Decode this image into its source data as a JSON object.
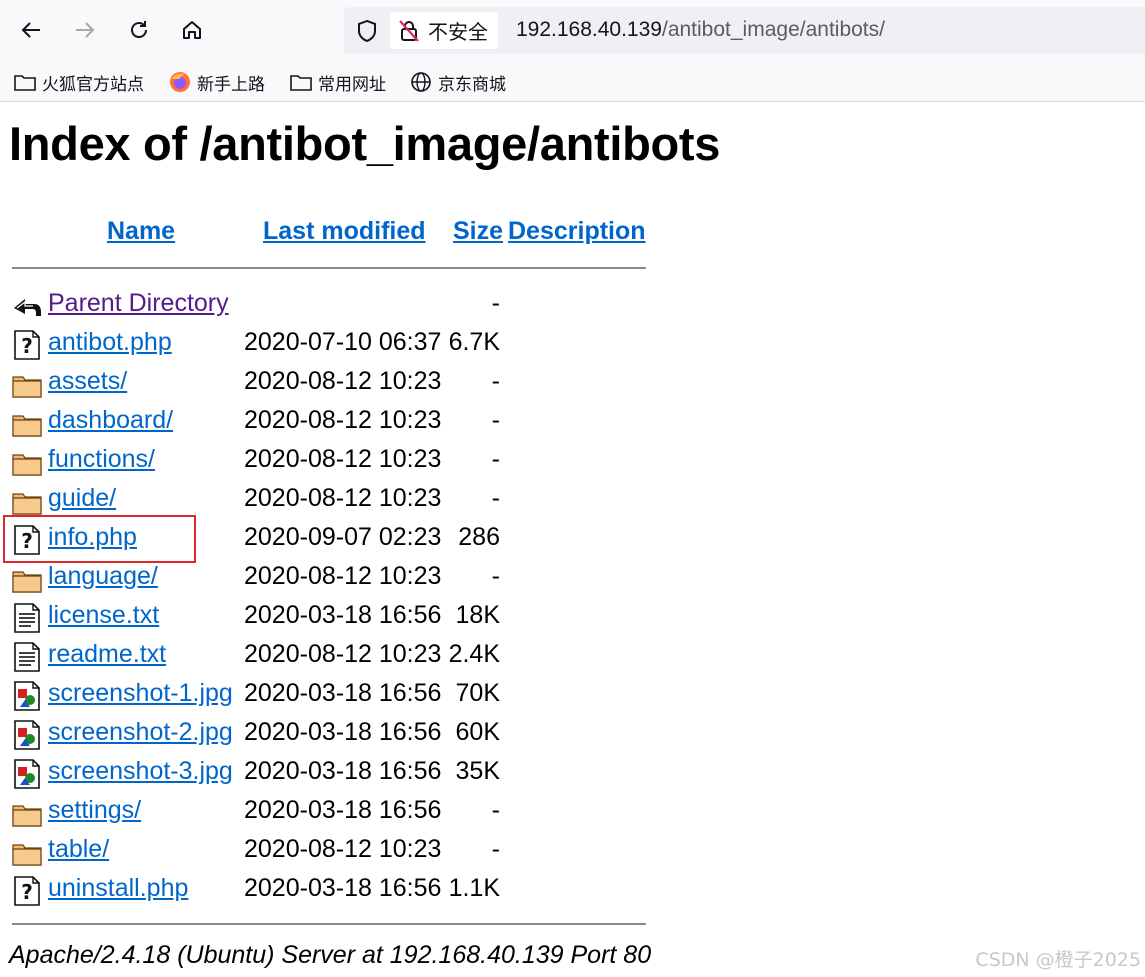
{
  "browser": {
    "security_label": "不安全",
    "url_host": "192.168.40.139",
    "url_path": "/antibot_image/antibots/",
    "bookmarks": [
      {
        "label": "火狐官方站点",
        "icon": "folder-icon"
      },
      {
        "label": "新手上路",
        "icon": "firefox-icon"
      },
      {
        "label": "常用网址",
        "icon": "folder-icon"
      },
      {
        "label": "京东商城",
        "icon": "globe-icon"
      }
    ]
  },
  "page": {
    "title": "Index of /antibot_image/antibots",
    "columns": {
      "name": "Name",
      "last_modified": "Last modified",
      "size": "Size",
      "description": "Description"
    },
    "entries": [
      {
        "name": "Parent Directory",
        "date": "",
        "size": "-",
        "icon": "back-icon",
        "visited": true
      },
      {
        "name": "antibot.php",
        "date": "2020-07-10 06:37",
        "size": "6.7K",
        "icon": "unknown-file-icon"
      },
      {
        "name": "assets/",
        "date": "2020-08-12 10:23",
        "size": "-",
        "icon": "folder-icon"
      },
      {
        "name": "dashboard/",
        "date": "2020-08-12 10:23",
        "size": "-",
        "icon": "folder-icon"
      },
      {
        "name": "functions/",
        "date": "2020-08-12 10:23",
        "size": "-",
        "icon": "folder-icon"
      },
      {
        "name": "guide/",
        "date": "2020-08-12 10:23",
        "size": "-",
        "icon": "folder-icon"
      },
      {
        "name": "info.php",
        "date": "2020-09-07 02:23",
        "size": "286",
        "icon": "unknown-file-icon",
        "highlighted": true
      },
      {
        "name": "language/",
        "date": "2020-08-12 10:23",
        "size": "-",
        "icon": "folder-icon"
      },
      {
        "name": "license.txt",
        "date": "2020-03-18 16:56",
        "size": "18K",
        "icon": "text-file-icon"
      },
      {
        "name": "readme.txt",
        "date": "2020-08-12 10:23",
        "size": "2.4K",
        "icon": "text-file-icon"
      },
      {
        "name": "screenshot-1.jpg",
        "date": "2020-03-18 16:56",
        "size": "70K",
        "icon": "image-file-icon"
      },
      {
        "name": "screenshot-2.jpg",
        "date": "2020-03-18 16:56",
        "size": "60K",
        "icon": "image-file-icon"
      },
      {
        "name": "screenshot-3.jpg",
        "date": "2020-03-18 16:56",
        "size": "35K",
        "icon": "image-file-icon"
      },
      {
        "name": "settings/",
        "date": "2020-03-18 16:56",
        "size": "-",
        "icon": "folder-icon"
      },
      {
        "name": "table/",
        "date": "2020-08-12 10:23",
        "size": "-",
        "icon": "folder-icon"
      },
      {
        "name": "uninstall.php",
        "date": "2020-03-18 16:56",
        "size": "1.1K",
        "icon": "unknown-file-icon"
      }
    ],
    "server_signature": "Apache/2.4.18 (Ubuntu) Server at 192.168.40.139 Port 80"
  },
  "watermark": "CSDN @橙子2025",
  "colors": {
    "link": "#0066cc",
    "visited": "#551a8b",
    "highlight_box": "#e0252b"
  }
}
